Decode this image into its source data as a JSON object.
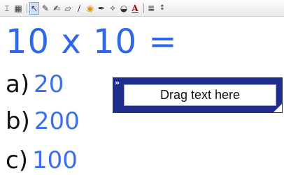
{
  "toolbar": {
    "tools": [
      {
        "icon": "text-tool-icon",
        "glyph": "⌶"
      },
      {
        "icon": "table-icon",
        "glyph": "▦"
      },
      {
        "icon": "select-arrow-icon",
        "glyph": "↖"
      },
      {
        "icon": "pen-icon",
        "glyph": "✎"
      },
      {
        "icon": "highlighter-icon",
        "glyph": "✍"
      },
      {
        "icon": "eraser-icon",
        "glyph": "▱"
      },
      {
        "icon": "line-icon",
        "glyph": "∕"
      },
      {
        "icon": "fill-bucket-icon",
        "glyph": "◉"
      },
      {
        "icon": "magic-pen-icon",
        "glyph": "✒"
      },
      {
        "icon": "shape-icon",
        "glyph": "✧"
      },
      {
        "icon": "color-picker-icon",
        "glyph": "◒"
      },
      {
        "icon": "text-color-icon",
        "glyph": "A"
      },
      {
        "icon": "properties-icon",
        "glyph": "≣"
      },
      {
        "icon": "more-options-icon",
        "glyph": "↕"
      }
    ]
  },
  "question": "10 x 10 =",
  "options": [
    {
      "letter": "a)",
      "value": "20"
    },
    {
      "letter": "b)",
      "value": "200"
    },
    {
      "letter": "c)",
      "value": "100"
    }
  ],
  "drag_box": {
    "label": "Drag text here",
    "handle_glyph": "»"
  },
  "colors": {
    "question_blue": "#2f66ee",
    "answer_blue": "#3a6ff0",
    "drag_box_navy": "#1f2e8c"
  }
}
